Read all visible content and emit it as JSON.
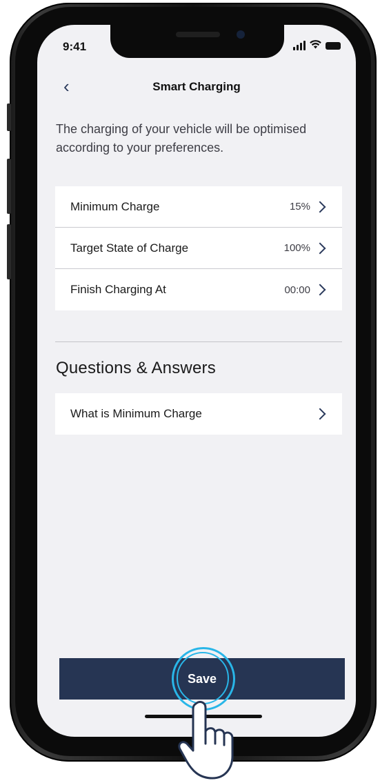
{
  "status_bar": {
    "time": "9:41"
  },
  "nav": {
    "back_icon": "chevron-left-icon",
    "title": "Smart Charging"
  },
  "intro_text": "The charging of your vehicle will be optimised according to your preferences.",
  "settings": [
    {
      "label": "Minimum Charge",
      "value": "15%"
    },
    {
      "label": "Target State of Charge",
      "value": "100%"
    },
    {
      "label": "Finish Charging At",
      "value": "00:00"
    }
  ],
  "qa": {
    "title": "Questions & Answers",
    "items": [
      {
        "label": "What is Minimum Charge"
      }
    ]
  },
  "save_button": {
    "label": "Save"
  },
  "colors": {
    "accent": "#263553",
    "tap_ring": "#29b6e8",
    "background": "#f1f1f4"
  }
}
